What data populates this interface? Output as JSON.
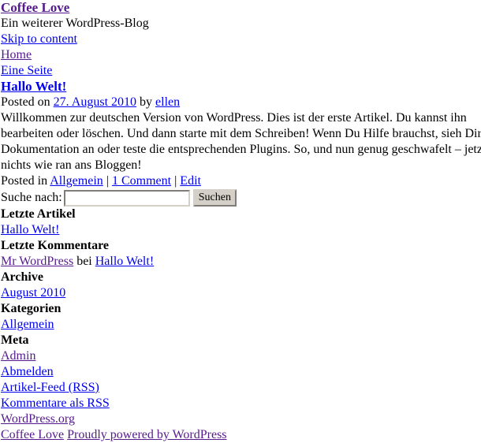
{
  "colors": {
    "link": "#0000EE",
    "visited_link": "#551A8B",
    "text": "#000000",
    "background": "#FFFFFF"
  },
  "header": {
    "site_title": "Coffee Love",
    "tagline": "Ein weiterer WordPress-Blog",
    "skip_link": "Skip to content"
  },
  "nav": {
    "items": [
      {
        "label": "Home"
      },
      {
        "label": "Eine Seite"
      }
    ]
  },
  "post": {
    "title": "Hallo Welt!",
    "meta_prefix": "Posted on ",
    "date": "27. August 2010",
    "meta_by": " by ",
    "author": "ellen",
    "content": "Willkommen zur deutschen Version von WordPress. Dies ist der erste Artikel. Du kannst ihn bearbeiten oder löschen. Und dann starte mit dem Schreiben! Wenn Du Hilfe brauchst, sieh Dir die Dokumentation an oder teste die entsprechenden Plugins. So, und nun genug geschwafelt – jetzt nichts wie ran ans Bloggen!",
    "utility_prefix": "Posted in ",
    "category": "Allgemein",
    "separator": " | ",
    "comments": "1 Comment",
    "edit": "Edit"
  },
  "search": {
    "label": "Suche nach:",
    "value": "",
    "placeholder": "",
    "submit_label": "Suchen"
  },
  "widgets": [
    {
      "title": "Letzte Artikel",
      "items": [
        {
          "label": "Hallo Welt!",
          "visited": false
        }
      ]
    },
    {
      "title": "Letzte Kommentare",
      "comment_author": "Mr WordPress",
      "comment_joiner": " bei ",
      "comment_post": "Hallo Welt!"
    },
    {
      "title": "Archive",
      "items": [
        {
          "label": "August 2010",
          "visited": false
        }
      ]
    },
    {
      "title": "Kategorien",
      "items": [
        {
          "label": "Allgemein",
          "visited": false
        }
      ]
    },
    {
      "title": "Meta",
      "items": [
        {
          "label": "Admin",
          "visited": true
        },
        {
          "label": "Abmelden",
          "visited": false
        },
        {
          "label": "Artikel-Feed (RSS)",
          "visited": false
        },
        {
          "label": "Kommentare als RSS",
          "visited": false
        },
        {
          "label": "WordPress.org",
          "visited": true
        }
      ]
    }
  ],
  "footer": {
    "site_link": "Coffee Love",
    "credit_link": "Proudly powered by WordPress"
  }
}
